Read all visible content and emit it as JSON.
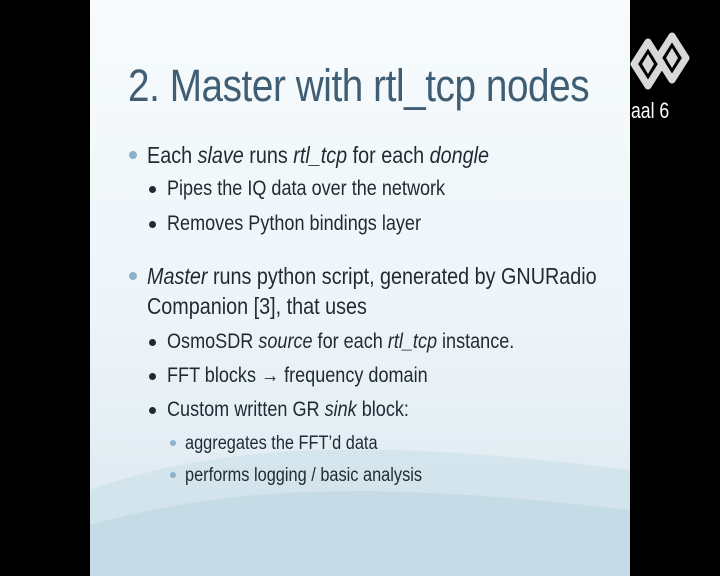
{
  "slide": {
    "title": "2. Master with rtl_tcp nodes",
    "bullets": {
      "b1": {
        "a": "Each ",
        "b": "slave",
        "c": " runs ",
        "d": "rtl_tcp",
        "e": " for each ",
        "f": "dongle"
      },
      "b1_1": "Pipes the IQ data over the network",
      "b1_2": "Removes Python bindings layer",
      "b2": {
        "a": "Master",
        "b": " runs python script, generated by GNURadio",
        "c": "Companion [3], that uses"
      },
      "b2_1": {
        "a": "OsmoSDR ",
        "b": "source",
        "c": " for each ",
        "d": "rtl_tcp",
        "e": " instance."
      },
      "b2_2": "FFT blocks → frequency domain",
      "b2_3": {
        "a": "Custom written GR ",
        "b": "sink",
        "c": " block:"
      },
      "b2_3_1": "aggregates the FFT’d data",
      "b2_3_2": "performs logging / basic analysis"
    }
  },
  "overlay": {
    "channel_label": "aal 6",
    "logo_icon": "channel-logo-icon",
    "colors": {
      "slide_title": "#3f5e74",
      "bullet_accent": "#8cb1c8",
      "text": "#1f2a33"
    }
  }
}
